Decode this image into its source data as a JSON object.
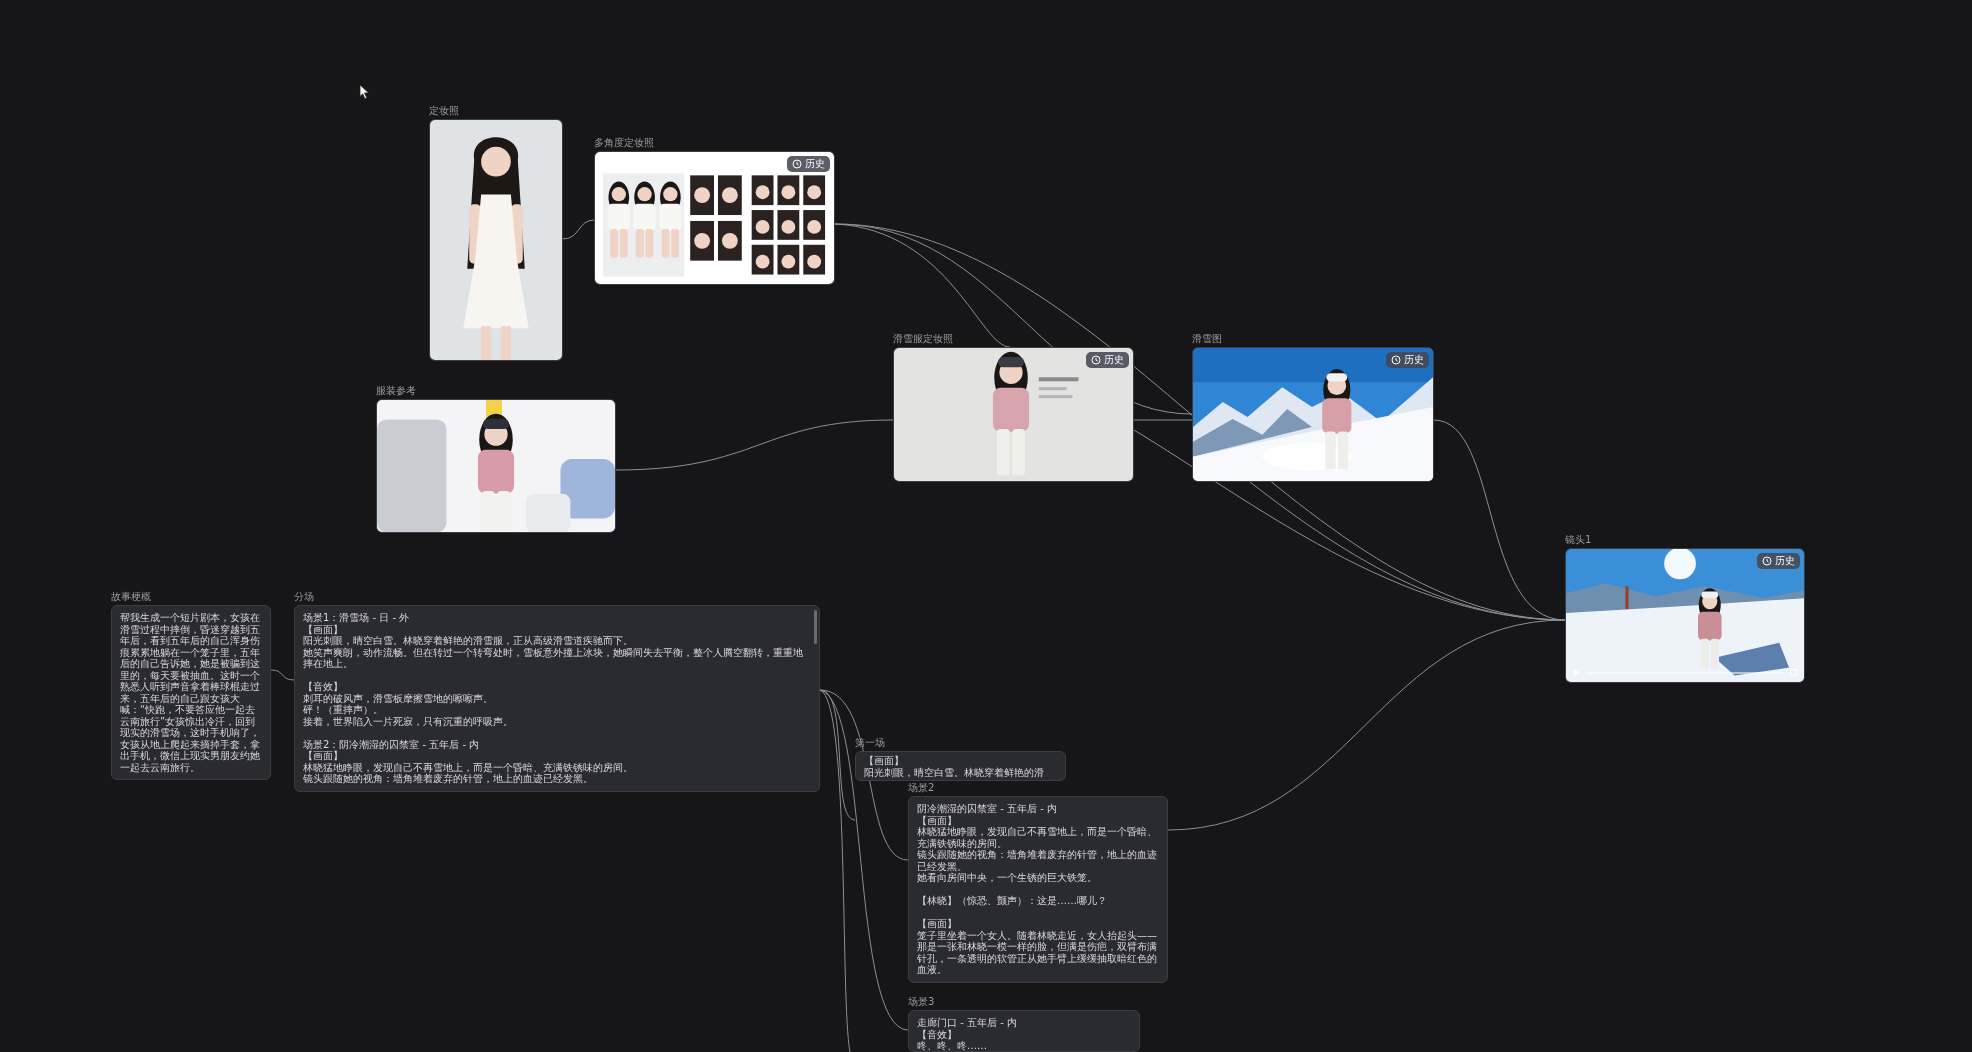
{
  "canvas": {
    "nodes": [
      {
        "kind": "picture",
        "label": "定妆照"
      },
      {
        "kind": "picture",
        "label": "多角度定妆照",
        "history": "历史"
      },
      {
        "kind": "picture",
        "label": "服装参考"
      },
      {
        "kind": "picture",
        "label": "滑雪服定妆照",
        "history": "历史"
      },
      {
        "kind": "picture",
        "label": "滑雪图",
        "history": "历史"
      },
      {
        "kind": "video",
        "label": "镜头1",
        "history": "历史"
      },
      {
        "kind": "text",
        "label": "故事梗概",
        "blocks": [
          [
            "帮我生成一个短片剧本，女孩在滑雪过程中摔倒，昏迷穿越到五年后，看到五年后的自己浑身伤痕累累地躺在一个笼子里，五年后的自己告诉她，她是被骗到这里的，每天要被抽血。这时一个熟悉人听到声音拿着棒球棍走过来，五年后的自己跟女孩大喊：“快跑，不要答应他一起去云南旅行”女孩惊出冷汗，回到现实的滑雪场，这时手机响了，女孩从地上爬起来摘掉手套，拿出手机，微信上现实男朋友约她一起去云南旅行。"
          ]
        ]
      },
      {
        "kind": "text",
        "label": "分场",
        "blocks": [
          [
            "场景1：滑雪场 - 日 - 外",
            "【画面】",
            "阳光刺眼，晴空白雪。林晓穿着鲜艳的滑雪服，正从高级滑雪道疾驰而下。",
            "她笑声爽朗，动作流畅。但在转过一个转弯处时，雪板意外撞上冰块，她瞬间失去平衡，整个人腾空翻转，重重地摔在地上。"
          ],
          [
            "【音效】",
            "刺耳的破风声，滑雪板摩擦雪地的嚓嚓声。",
            "砰！（重摔声）。",
            "接着，世界陷入一片死寂，只有沉重的呼吸声。"
          ],
          [
            "场景2：阴冷潮湿的囚禁室 - 五年后 - 内",
            "【画面】",
            "林晓猛地睁眼，发现自己不再雪地上，而是一个昏暗、充满铁锈味的房间。",
            "镜头跟随她的视角：墙角堆着废弃的针管，地上的血迹已经发黑。"
          ]
        ]
      },
      {
        "kind": "text",
        "label": "第一场",
        "blocks": [
          [
            "【画面】",
            "阳光刺眼，晴空白雪。林晓穿着鲜艳的滑"
          ]
        ]
      },
      {
        "kind": "text",
        "label": "场景2",
        "blocks": [
          [
            "阴冷潮湿的囚禁室 - 五年后 - 内",
            "【画面】",
            "林晓猛地睁眼，发现自己不再雪地上，而是一个昏暗、充满铁锈味的房间。",
            "镜头跟随她的视角：墙角堆着废弃的针管，地上的血迹已经发黑。",
            "她看向房间中央，一个生锈的巨大铁笼。"
          ],
          [
            "【林晓】（惊恐、颤声）：这是……哪儿？"
          ],
          [
            "【画面】",
            "笼子里坐着一个女人。随着林晓走近，女人抬起头——那是一张和林晓一模一样的脸，但满是伤疤，双臂布满针孔，一条透明的软管正从她手臂上缓缓抽取暗红色的血液。"
          ]
        ]
      },
      {
        "kind": "text",
        "label": "场景3",
        "blocks": [
          [
            "走廊门口 - 五年后 - 内",
            "【音效】",
            "咚、咚、咚……"
          ]
        ]
      }
    ]
  }
}
